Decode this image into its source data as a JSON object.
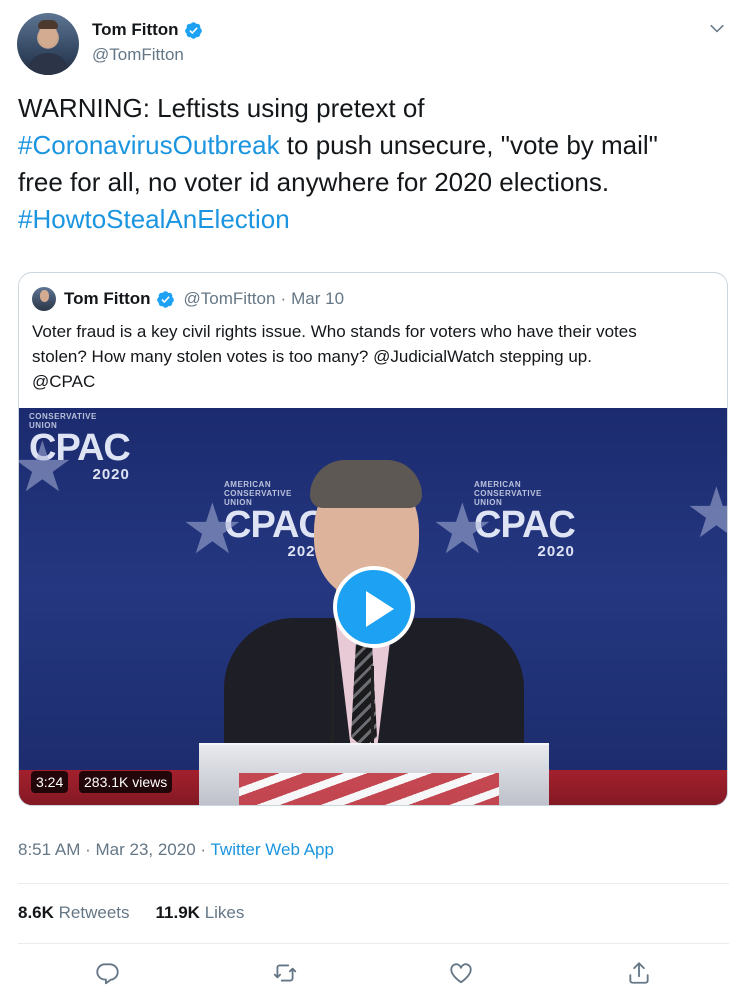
{
  "author": {
    "name": "Tom Fitton",
    "handle": "@TomFitton"
  },
  "tweet": {
    "line1": "WARNING: Leftists using pretext of",
    "hashtag1": "#CoronavirusOutbreak",
    "line2_rest": " to push unsecure, \"vote by mail\"",
    "line3": "free for all, no voter id anywhere for 2020 elections.",
    "hashtag2": "#HowtoStealAnElection"
  },
  "quoted": {
    "name": "Tom Fitton",
    "handle": "@TomFitton",
    "separator": "·",
    "date": "Mar 10",
    "text_line1": "Voter fraud is a key civil rights issue. Who stands for voters who have their votes",
    "text_line2": "stolen?  How many stolen votes is too many? @JudicialWatch stepping up.",
    "text_line3": "@CPAC",
    "video": {
      "duration": "3:24",
      "views": "283.1K views",
      "logos": [
        {
          "line1": "CONSERVATIVE",
          "line2": "UNION",
          "big": "CPAC",
          "year": "2020"
        },
        {
          "line1": "AMERICAN",
          "line2": "CONSERVATIVE",
          "line3": "UNION",
          "big": "CPAC",
          "year": "2020"
        },
        {
          "line1": "AMERICAN",
          "line2": "CONSERVATIVE",
          "line3": "UNION",
          "big": "CPAC",
          "year": "2020"
        }
      ]
    }
  },
  "meta": {
    "time": "8:51 AM",
    "separator": " · ",
    "date": "Mar 23, 2020",
    "separator2": " · ",
    "source": "Twitter Web App"
  },
  "stats": {
    "retweets_count": "8.6K",
    "retweets_label": "Retweets",
    "likes_count": "11.9K",
    "likes_label": "Likes"
  },
  "actions": [
    "reply-icon",
    "retweet-icon",
    "like-icon",
    "share-icon"
  ],
  "colors": {
    "link": "#1b95e0",
    "secondary_text": "#657786",
    "primary_text": "#14171a",
    "play_button": "#1da1f2"
  }
}
